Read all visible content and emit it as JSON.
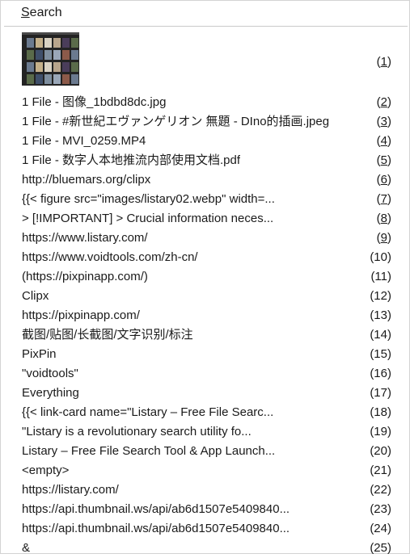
{
  "header": {
    "title_mnemonic": "S",
    "title_rest": "earch"
  },
  "thumbnail_item": {
    "num_prefix": "(",
    "num_digit": "1",
    "num_suffix": ")"
  },
  "items": [
    {
      "label": "1 File - 图像_1bdbd8dc.jpg",
      "pre": "(",
      "digit": "2",
      "post": ")"
    },
    {
      "label": "1 File - #新世紀エヴァンゲリオン 無題 - DIno的插画.jpeg",
      "pre": "(",
      "digit": "3",
      "post": ")"
    },
    {
      "label": "1 File - MVI_0259.MP4",
      "pre": "(",
      "digit": "4",
      "post": ")"
    },
    {
      "label": "1 File - 数字人本地推流内部使用文档.pdf",
      "pre": "(",
      "digit": "5",
      "post": ")"
    },
    {
      "label": "http://bluemars.org/clipx",
      "pre": "(",
      "digit": "6",
      "post": ")"
    },
    {
      "label": "{{< figure src=\"images/listary02.webp\" width=...",
      "pre": "(",
      "digit": "7",
      "post": ")"
    },
    {
      "label": "> [!IMPORTANT]    > Crucial information neces...",
      "pre": "(",
      "digit": "8",
      "post": ")"
    },
    {
      "label": "https://www.listary.com/",
      "pre": "(",
      "digit": "9",
      "post": ")"
    },
    {
      "label": "https://www.voidtools.com/zh-cn/",
      "pre": "(10)",
      "digit": "",
      "post": ""
    },
    {
      "label": "(https://pixpinapp.com/)",
      "pre": "(11)",
      "digit": "",
      "post": ""
    },
    {
      "label": "Clipx",
      "pre": "(12)",
      "digit": "",
      "post": ""
    },
    {
      "label": "https://pixpinapp.com/",
      "pre": "(13)",
      "digit": "",
      "post": ""
    },
    {
      "label": "截图/贴图/长截图/文字识别/标注",
      "pre": "(14)",
      "digit": "",
      "post": ""
    },
    {
      "label": "PixPin",
      "pre": "(15)",
      "digit": "",
      "post": ""
    },
    {
      "label": "\"voidtools\"",
      "pre": "(16)",
      "digit": "",
      "post": ""
    },
    {
      "label": "Everything",
      "pre": "(17)",
      "digit": "",
      "post": ""
    },
    {
      "label": "{{< link-card name=\"Listary – Free File Searc...",
      "pre": "(18)",
      "digit": "",
      "post": ""
    },
    {
      "label": "\"Listary is a revolutionary search utility fo...",
      "pre": "(19)",
      "digit": "",
      "post": ""
    },
    {
      "label": "Listary – Free File Search Tool & App Launch...",
      "pre": "(20)",
      "digit": "",
      "post": ""
    },
    {
      "label": "<empty>",
      "pre": "(21)",
      "digit": "",
      "post": ""
    },
    {
      "label": "https://listary.com/",
      "pre": "(22)",
      "digit": "",
      "post": ""
    },
    {
      "label": "https://api.thumbnail.ws/api/ab6d1507e5409840...",
      "pre": "(23)",
      "digit": "",
      "post": ""
    },
    {
      "label": "https://api.thumbnail.ws/api/ab6d1507e5409840...",
      "pre": "(24)",
      "digit": "",
      "post": ""
    },
    {
      "label": "&",
      "pre": "(25)",
      "digit": "",
      "post": ""
    }
  ],
  "colors": {
    "background": "#ffffff",
    "text": "#1a1a1a",
    "border": "#d3d3d3",
    "separator": "#c9c9c9",
    "thumbnail_bg": "#232323"
  }
}
